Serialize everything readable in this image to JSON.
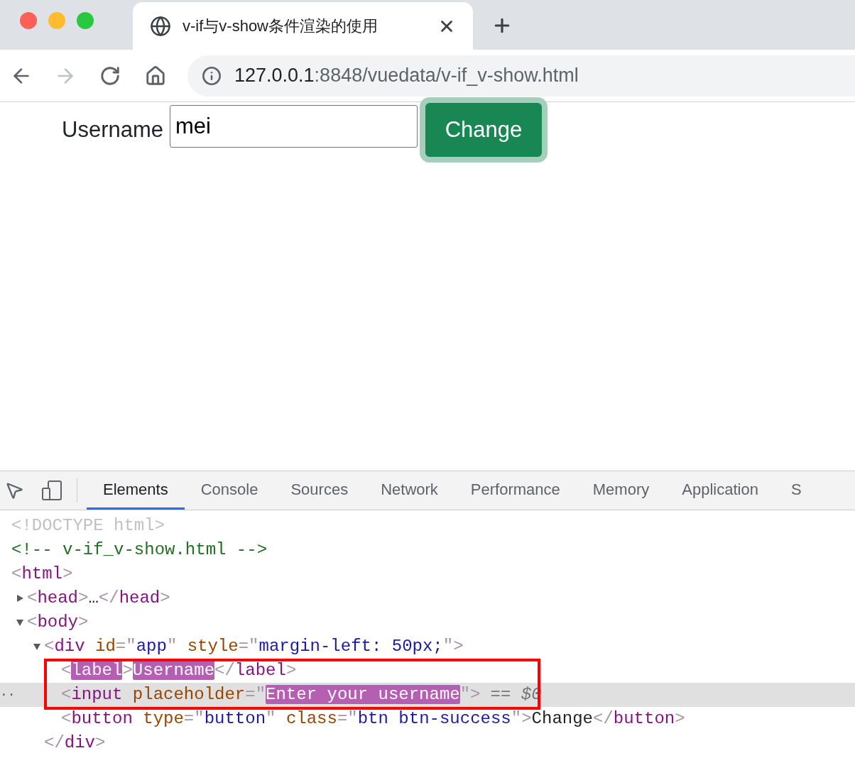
{
  "browser": {
    "tab": {
      "title": "v-if与v-show条件渲染的使用"
    },
    "address": {
      "host": "127.0.0.1",
      "path": ":8848/vuedata/v-if_v-show.html"
    }
  },
  "page": {
    "label": "Username",
    "input": {
      "value": "mei"
    },
    "button": {
      "label": "Change",
      "focused": true
    }
  },
  "devtools": {
    "tabs": [
      {
        "label": "Elements",
        "selected": true
      },
      {
        "label": "Console",
        "selected": false
      },
      {
        "label": "Sources",
        "selected": false
      },
      {
        "label": "Network",
        "selected": false
      },
      {
        "label": "Performance",
        "selected": false
      },
      {
        "label": "Memory",
        "selected": false
      },
      {
        "label": "Application",
        "selected": false
      },
      {
        "label": "S",
        "selected": false
      }
    ],
    "dom_tree": [
      {
        "selected": false,
        "tokens": [
          {
            "kind": "doctype",
            "text": "<!DOCTYPE html>"
          }
        ]
      },
      {
        "selected": false,
        "tokens": [
          {
            "kind": "comment",
            "text": "<!-- v-if_v-show.html -->"
          }
        ]
      },
      {
        "selected": false,
        "tokens": [
          {
            "kind": "punct",
            "text": "<"
          },
          {
            "kind": "tag",
            "text": "html"
          },
          {
            "kind": "punct",
            "text": ">"
          }
        ],
        "children": [
          {
            "selected": false,
            "expanded": false,
            "tokens": [
              {
                "kind": "punct",
                "text": "<"
              },
              {
                "kind": "tag",
                "text": "head"
              },
              {
                "kind": "punct",
                "text": ">"
              },
              {
                "kind": "text",
                "text": "…"
              },
              {
                "kind": "punct",
                "text": "</"
              },
              {
                "kind": "tag",
                "text": "head"
              },
              {
                "kind": "punct",
                "text": ">"
              }
            ]
          },
          {
            "selected": false,
            "expanded": true,
            "tokens": [
              {
                "kind": "punct",
                "text": "<"
              },
              {
                "kind": "tag",
                "text": "body"
              },
              {
                "kind": "punct",
                "text": ">"
              }
            ],
            "children": [
              {
                "selected": false,
                "expanded": true,
                "tokens": [
                  {
                    "kind": "punct",
                    "text": "<"
                  },
                  {
                    "kind": "tag",
                    "text": "div"
                  },
                  {
                    "kind": "attr",
                    "text": " id"
                  },
                  {
                    "kind": "punct",
                    "text": "=\""
                  },
                  {
                    "kind": "value",
                    "text": "app"
                  },
                  {
                    "kind": "punct",
                    "text": "\""
                  },
                  {
                    "kind": "attr",
                    "text": " style"
                  },
                  {
                    "kind": "punct",
                    "text": "=\""
                  },
                  {
                    "kind": "value",
                    "text": "margin-left: 50px;"
                  },
                  {
                    "kind": "punct",
                    "text": "\">"
                  }
                ],
                "closing": [
                  {
                    "kind": "punct",
                    "text": "</"
                  },
                  {
                    "kind": "tag",
                    "text": "div"
                  },
                  {
                    "kind": "punct",
                    "text": ">"
                  }
                ],
                "children": [
                  {
                    "selected": false,
                    "tokens": [
                      {
                        "kind": "punct",
                        "text": "<"
                      },
                      {
                        "kind": "tag",
                        "text": "label",
                        "highlighted": true
                      },
                      {
                        "kind": "punct",
                        "text": ">"
                      },
                      {
                        "kind": "text",
                        "text": "Username",
                        "highlighted": true
                      },
                      {
                        "kind": "punct",
                        "text": "</"
                      },
                      {
                        "kind": "tag",
                        "text": "label"
                      },
                      {
                        "kind": "punct",
                        "text": ">"
                      }
                    ]
                  },
                  {
                    "selected": true,
                    "gutter": "··",
                    "suffix": "== *$0*",
                    "tokens": [
                      {
                        "kind": "punct",
                        "text": "<"
                      },
                      {
                        "kind": "tag",
                        "text": "input"
                      },
                      {
                        "kind": "attr",
                        "text": " placeholder"
                      },
                      {
                        "kind": "punct",
                        "text": "=\""
                      },
                      {
                        "kind": "value",
                        "text": "Enter your username",
                        "highlighted": true
                      },
                      {
                        "kind": "punct",
                        "text": "\">"
                      }
                    ]
                  },
                  {
                    "selected": false,
                    "tokens": [
                      {
                        "kind": "punct",
                        "text": "<"
                      },
                      {
                        "kind": "tag",
                        "text": "button"
                      },
                      {
                        "kind": "attr",
                        "text": " type"
                      },
                      {
                        "kind": "punct",
                        "text": "=\""
                      },
                      {
                        "kind": "value",
                        "text": "button"
                      },
                      {
                        "kind": "punct",
                        "text": "\""
                      },
                      {
                        "kind": "attr",
                        "text": " class"
                      },
                      {
                        "kind": "punct",
                        "text": "=\""
                      },
                      {
                        "kind": "value",
                        "text": "btn btn-success"
                      },
                      {
                        "kind": "punct",
                        "text": "\">"
                      },
                      {
                        "kind": "text",
                        "text": "Change"
                      },
                      {
                        "kind": "punct",
                        "text": "</"
                      },
                      {
                        "kind": "tag",
                        "text": "button"
                      },
                      {
                        "kind": "punct",
                        "text": ">"
                      }
                    ]
                  }
                ]
              }
            ]
          }
        ]
      }
    ]
  }
}
